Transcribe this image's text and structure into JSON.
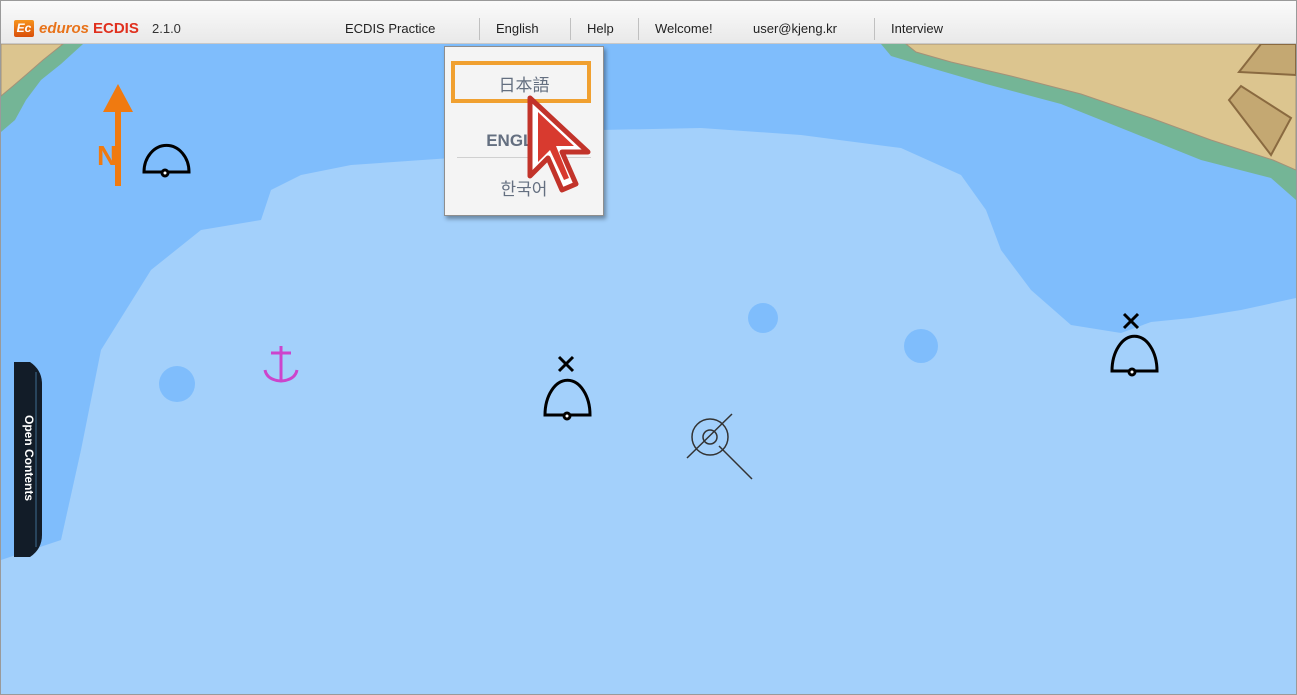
{
  "app": {
    "logo_text": "Ec",
    "brand_name": "eduros",
    "brand_product": "ECDIS",
    "version": "2.1.0"
  },
  "nav": {
    "practice": "ECDIS Practice",
    "language": "English",
    "help": "Help",
    "welcome": "Welcome!",
    "user": "user@kjeng.kr",
    "interview": "Interview"
  },
  "language_menu": {
    "options": [
      "日本語",
      "ENGLISH",
      "한국어"
    ],
    "highlighted": "日本語"
  },
  "side_panel": {
    "label": "Open Contents"
  },
  "chart_symbols": [
    "north-arrow-icon",
    "buoy-icon",
    "anchorage-icon",
    "wreck-icon"
  ],
  "colors": {
    "deep_water": "#7fbdfc",
    "shallow_water": "#a3d0fb",
    "land": "#dcc58f",
    "intertidal": "#74b596",
    "anchor": "#cc44cc",
    "north_arrow": "#f07a10",
    "highlight": "#f0a030",
    "cursor": "#d83a2f"
  }
}
